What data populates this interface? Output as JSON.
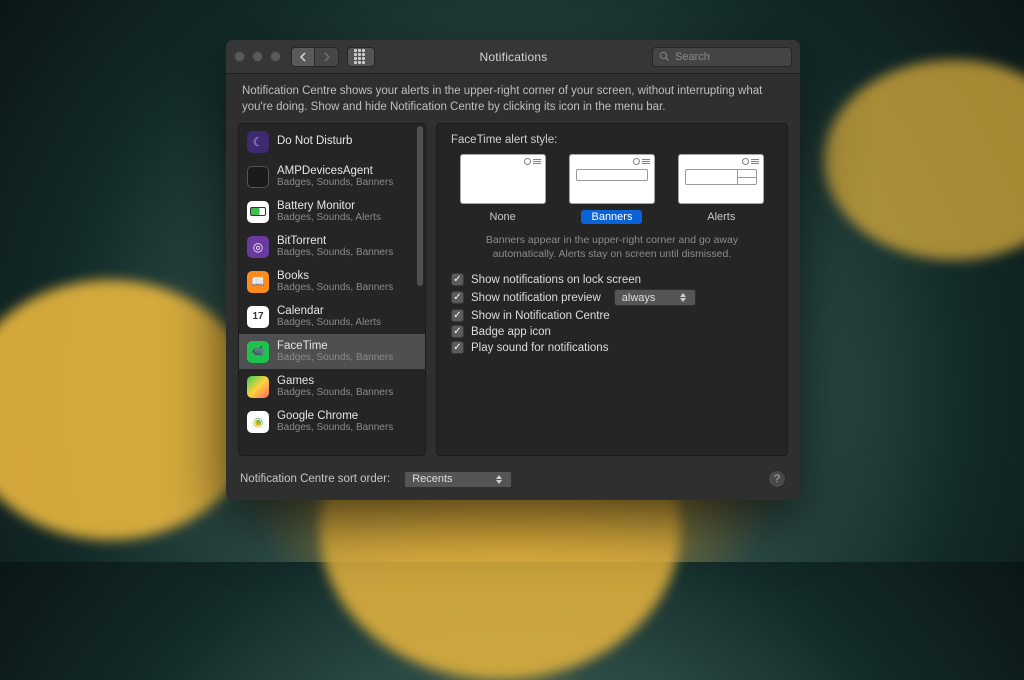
{
  "window": {
    "title": "Notifications"
  },
  "search": {
    "placeholder": "Search"
  },
  "description": "Notification Centre shows your alerts in the upper-right corner of your screen, without interrupting what you're doing. Show and hide Notification Centre by clicking its icon in the menu bar.",
  "sidebar": {
    "items": [
      {
        "name": "Do Not Disturb",
        "caption": "",
        "icon": "ic-dnd"
      },
      {
        "name": "AMPDevicesAgent",
        "caption": "Badges, Sounds, Banners",
        "icon": "ic-amp"
      },
      {
        "name": "Battery Monitor",
        "caption": "Badges, Sounds, Alerts",
        "icon": "ic-bat"
      },
      {
        "name": "BitTorrent",
        "caption": "Badges, Sounds, Banners",
        "icon": "ic-bit"
      },
      {
        "name": "Books",
        "caption": "Badges, Sounds, Banners",
        "icon": "ic-book"
      },
      {
        "name": "Calendar",
        "caption": "Badges, Sounds, Alerts",
        "icon": "ic-cal"
      },
      {
        "name": "FaceTime",
        "caption": "Badges, Sounds, Banners",
        "icon": "ic-ft",
        "selected": true
      },
      {
        "name": "Games",
        "caption": "Badges, Sounds, Banners",
        "icon": "ic-games"
      },
      {
        "name": "Google Chrome",
        "caption": "Badges, Sounds, Banners",
        "icon": "ic-chrome"
      }
    ]
  },
  "detail": {
    "heading": "FaceTime alert style:",
    "styles": [
      {
        "label": "None"
      },
      {
        "label": "Banners",
        "selected": true
      },
      {
        "label": "Alerts"
      }
    ],
    "hint": "Banners appear in the upper-right corner and go away automatically. Alerts stay on screen until dismissed.",
    "checks": {
      "lock": "Show notifications on lock screen",
      "preview": "Show notification preview",
      "preview_value": "always",
      "centre": "Show in Notification Centre",
      "badge": "Badge app icon",
      "sound": "Play sound for notifications"
    }
  },
  "footer": {
    "label": "Notification Centre sort order:",
    "value": "Recents"
  }
}
